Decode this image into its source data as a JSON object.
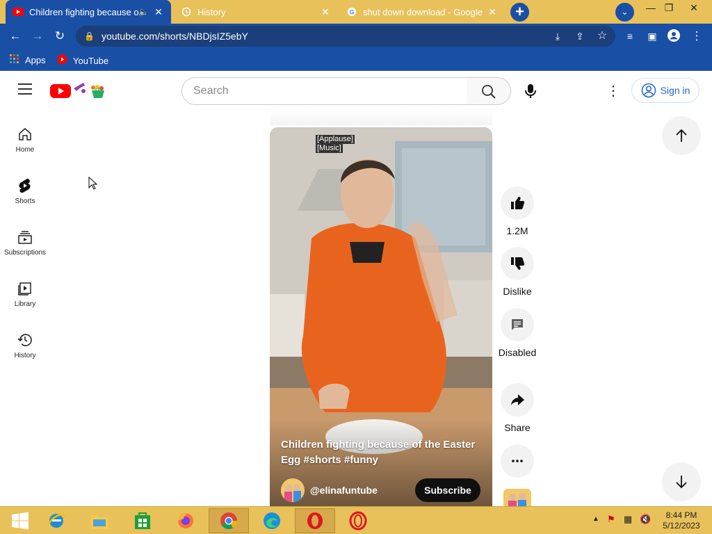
{
  "browser": {
    "tabs": [
      {
        "title": "Children fighting because of",
        "active": true,
        "icon": "youtube-favicon",
        "audio": true
      },
      {
        "title": "History",
        "active": false,
        "icon": "history-icon"
      },
      {
        "title": "shut down download - Google Se",
        "active": false,
        "icon": "google-favicon"
      }
    ],
    "url": "youtube.com/shorts/NBDjsIZ5ebY",
    "bookmarks": [
      {
        "label": "Apps",
        "icon": "apps-grid-icon"
      },
      {
        "label": "YouTube",
        "icon": "youtube-favicon"
      }
    ],
    "colors": {
      "tabbar": "#e8c15a",
      "toolbar": "#1a4fa6"
    }
  },
  "youtube": {
    "search_placeholder": "Search",
    "signin_label": "Sign in",
    "sidebar": [
      {
        "label": "Home",
        "icon": "home-icon"
      },
      {
        "label": "Shorts",
        "icon": "shorts-icon"
      },
      {
        "label": "Subscriptions",
        "icon": "subscriptions-icon"
      },
      {
        "label": "Library",
        "icon": "library-icon"
      },
      {
        "label": "History",
        "icon": "history-icon"
      }
    ],
    "short": {
      "captions": [
        "[Applause]",
        "[Music]"
      ],
      "title": "Children fighting because of the Easter Egg #shorts #funny",
      "channel": "@elinafuntube",
      "subscribe_label": "Subscribe"
    },
    "actions": {
      "like_count": "1.2M",
      "dislike_label": "Dislike",
      "comments_label": "Disabled",
      "share_label": "Share"
    }
  },
  "taskbar": {
    "time": "8:44 PM",
    "date": "5/12/2023",
    "apps": [
      "start-icon",
      "internet-explorer-icon",
      "file-explorer-icon",
      "store-icon",
      "firefox-icon",
      "chrome-icon",
      "edge-icon",
      "opera-icon",
      "opera-gx-icon"
    ]
  }
}
